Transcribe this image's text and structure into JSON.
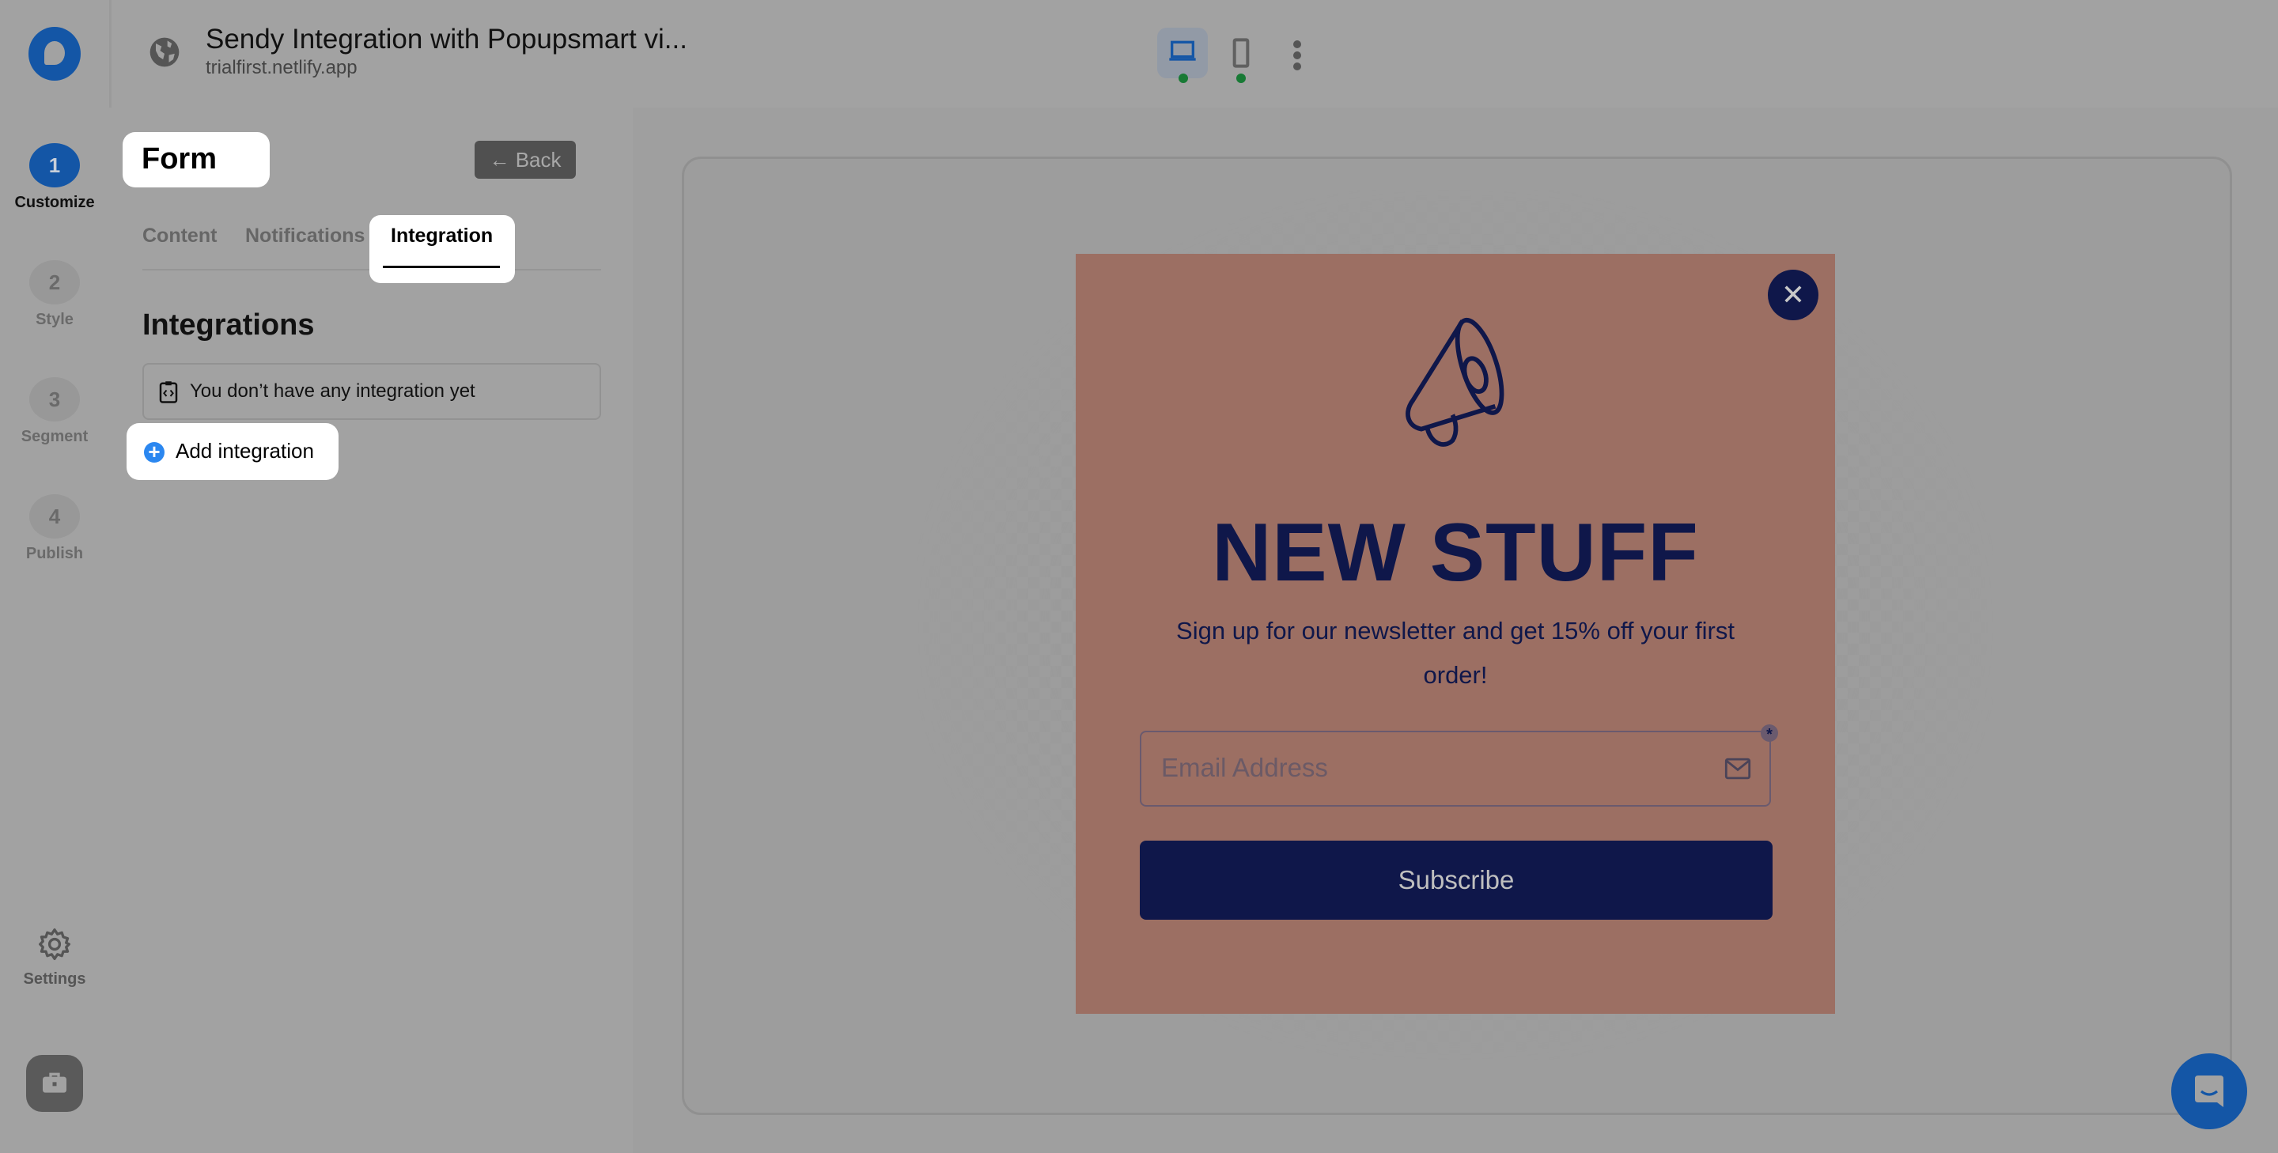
{
  "header": {
    "title": "Sendy Integration with Popupsmart vi...",
    "domain": "trialfirst.netlify.app",
    "devices": [
      {
        "name": "desktop",
        "active": true,
        "status_color": "#187a35"
      },
      {
        "name": "mobile",
        "active": false,
        "status_color": "#187a35"
      }
    ]
  },
  "steps": [
    {
      "number": "1",
      "label": "Customize",
      "active": true
    },
    {
      "number": "2",
      "label": "Style",
      "active": false
    },
    {
      "number": "3",
      "label": "Segment",
      "active": false
    },
    {
      "number": "4",
      "label": "Publish",
      "active": false
    }
  ],
  "settings_label": "Settings",
  "panel": {
    "title": "Form",
    "back_label": "Back",
    "tabs": [
      {
        "label": "Content",
        "active": false
      },
      {
        "label": "Notifications",
        "active": false
      },
      {
        "label": "Integration",
        "active": true
      }
    ],
    "section_heading": "Integrations",
    "empty_message": "You don’t have any integration yet",
    "add_label": "Add integration"
  },
  "popup": {
    "headline": "NEW STUFF",
    "description": "Sign up for our newsletter and get 15% off your first order!",
    "email_placeholder": "Email Address",
    "required_marker": "*",
    "subscribe_label": "Subscribe",
    "close_label": "✕",
    "background_color": "#9c6f63",
    "accent_color": "#0f174a"
  },
  "colors": {
    "brand": "#1456a6",
    "add_icon": "#2b87f0"
  }
}
